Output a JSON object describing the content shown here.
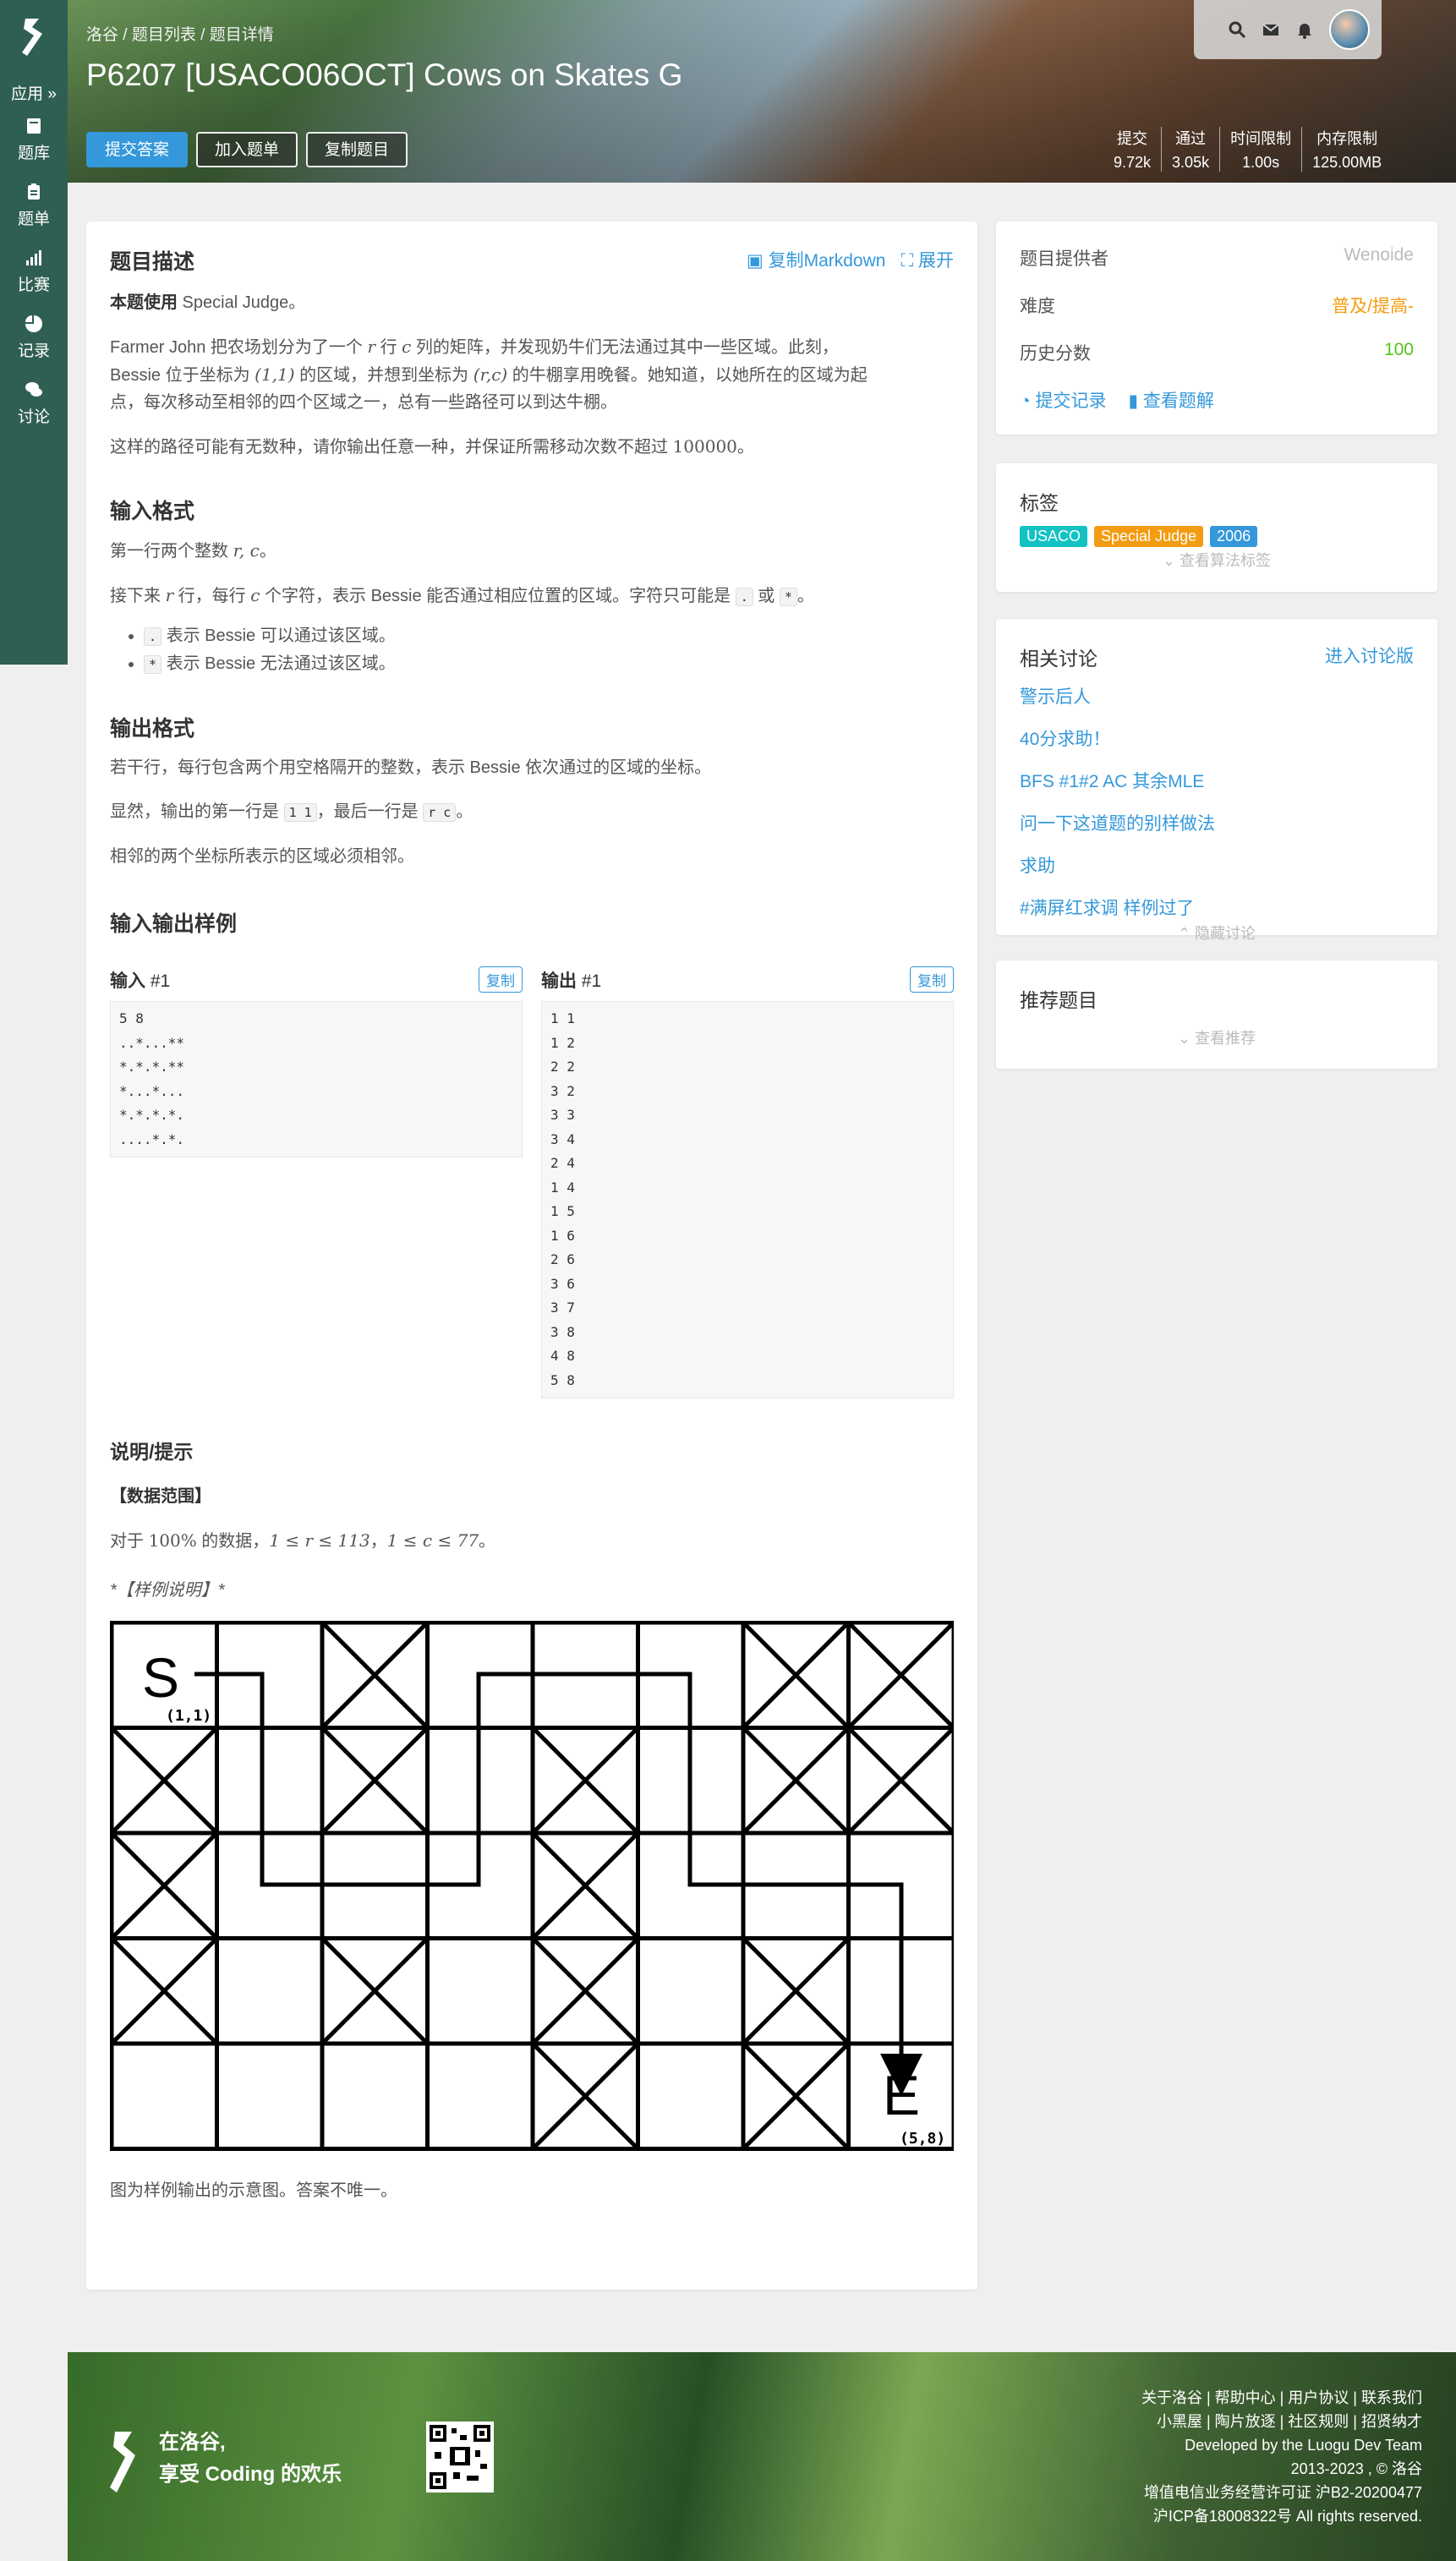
{
  "sidebar": {
    "items": [
      {
        "label": "应用 »",
        "icon": "apps-icon"
      },
      {
        "label": "题库",
        "icon": "book-icon"
      },
      {
        "label": "题单",
        "icon": "clipboard-icon"
      },
      {
        "label": "比赛",
        "icon": "bar-chart-icon"
      },
      {
        "label": "记录",
        "icon": "pie-chart-icon"
      },
      {
        "label": "讨论",
        "icon": "comments-icon"
      }
    ]
  },
  "header": {
    "breadcrumb": [
      "洛谷",
      "题目列表",
      "题目详情"
    ],
    "title": "P6207 [USACO06OCT] Cows on Skates G",
    "buttons": {
      "submit": "提交答案",
      "add_list": "加入题单",
      "copy": "复制题目"
    },
    "stats": [
      {
        "label": "提交",
        "value": "9.72k"
      },
      {
        "label": "通过",
        "value": "3.05k"
      },
      {
        "label": "时间限制",
        "value": "1.00s"
      },
      {
        "label": "内存限制",
        "value": "125.00MB"
      }
    ]
  },
  "problem": {
    "desc_title": "题目描述",
    "copy_md": "复制Markdown",
    "expand": "展开",
    "special_judge_bold": "本题使用",
    "special_judge_rest": " Special Judge。",
    "desc_p1_a": "Farmer John 把农场划分为了一个 ",
    "desc_p1_r": "r",
    "desc_p1_b": " 行 ",
    "desc_p1_c": "c",
    "desc_p1_c2": " 列的矩阵，并发现奶牛们无法通过其中一些区域。此刻，",
    "desc_p1_line2_a": "Bessie 位于坐标为 ",
    "desc_p1_coord1": "(1,1)",
    "desc_p1_line2_b": " 的区域，并想到坐标为 ",
    "desc_p1_coord2": "(r,c)",
    "desc_p1_line2_c": " 的牛棚享用晚餐。她知道，以她所在的区域为起",
    "desc_p1_line3": "点，每次移动至相邻的四个区域之一，总有一些路径可以到达牛棚。",
    "desc_p2_a": "这样的路径可能有无数种，请你输出任意一种，并保证所需移动次数不超过 ",
    "desc_p2_num": "100000",
    "desc_p2_b": "。",
    "input_title": "输入格式",
    "input_p1_a": "第一行两个整数 ",
    "input_p1_math": "r, c",
    "input_p1_b": "。",
    "input_p2_a": "接下来 ",
    "input_p2_r": "r",
    "input_p2_b": " 行，每行 ",
    "input_p2_c": "c",
    "input_p2_c2": " 个字符，表示 Bessie 能否通过相应位置的区域。字符只可能是 ",
    "input_p2_dot": ".",
    "input_p2_or": " 或 ",
    "input_p2_star": "*",
    "input_p2_end": "。",
    "input_li1_code": ".",
    "input_li1_text": " 表示 Bessie 可以通过该区域。",
    "input_li2_code": "*",
    "input_li2_text": " 表示 Bessie 无法通过该区域。",
    "output_title": "输出格式",
    "output_p1": "若干行，每行包含两个用空格隔开的整数，表示 Bessie 依次通过的区域的坐标。",
    "output_p2_a": "显然，输出的第一行是 ",
    "output_p2_code1": "1 1",
    "output_p2_b": "，最后一行是 ",
    "output_p2_code2": "r c",
    "output_p2_c": "。",
    "output_p3": "相邻的两个坐标所表示的区域必须相邻。",
    "sample_title": "输入输出样例",
    "sample_in_label": "输入",
    "sample_in_num": "#1",
    "sample_out_label": "输出",
    "sample_out_num": "#1",
    "copy_label": "复制",
    "sample_input": "5 8\n..*...**\n*.*.*.**\n*...*...\n*.*.*.*.\n....*.*.",
    "sample_output": "1 1\n1 2\n2 2\n3 2\n3 3\n3 4\n2 4\n1 4\n1 5\n1 6\n2 6\n3 6\n3 7\n3 8\n4 8\n5 8",
    "hint_title": "说明/提示",
    "range_title": "【数据范围】",
    "range_a": "对于 ",
    "range_pct": "100%",
    "range_b": " 的数据，",
    "range_c1": "1 ≤ r ≤ 113",
    "range_sep": "，",
    "range_c2": "1 ≤ c ≤ 77",
    "range_end": "。",
    "sample_explain": "*【样例说明】*",
    "figure_caption": "图为样例输出的示意图。答案不唯一。",
    "figure": {
      "start_label": "S",
      "start_coord": "(1,1)",
      "end_label": "E",
      "end_coord": "(5,8)",
      "grid": [
        "..*...**",
        "*.*.*.**",
        "*...*...",
        "*.*.*.*.",
        "....*.*."
      ]
    }
  },
  "info": {
    "provider_label": "题目提供者",
    "provider_value": "Wenoide",
    "difficulty_label": "难度",
    "difficulty_value": "普及/提高-",
    "difficulty_color": "#f39c11",
    "score_label": "历史分数",
    "score_value": "100",
    "score_color": "#52c41a",
    "records_link": "提交记录",
    "solutions_link": "查看题解"
  },
  "tags": {
    "title": "标签",
    "items": [
      {
        "label": "USACO",
        "color": "#13c2c2"
      },
      {
        "label": "Special Judge",
        "color": "#f39c11"
      },
      {
        "label": "2006",
        "color": "#3498db"
      }
    ],
    "toggle": "查看算法标签"
  },
  "discussions": {
    "title": "相关讨论",
    "enter": "进入讨论版",
    "items": [
      "警示后人",
      "40分求助！",
      "BFS #1#2 AC 其余MLE",
      "问一下这道题的别样做法",
      "求助",
      "#满屏红求调 样例过了"
    ],
    "toggle": "隐藏讨论"
  },
  "recommend": {
    "title": "推荐题目",
    "toggle": "查看推荐"
  },
  "footer": {
    "slogan_line1": "在洛谷,",
    "slogan_line2": "享受 Coding 的欢乐",
    "links1": "关于洛谷 | 帮助中心 | 用户协议 | 联系我们",
    "links2": "小黑屋 | 陶片放逐 | 社区规则 | 招贤纳才",
    "team": "Developed by the Luogu Dev Team",
    "copyright": "2013-2023 , © 洛谷",
    "license": "增值电信业务经营许可证 沪B2-20200477",
    "icp": "沪ICP备18008322号 All rights reserved."
  }
}
